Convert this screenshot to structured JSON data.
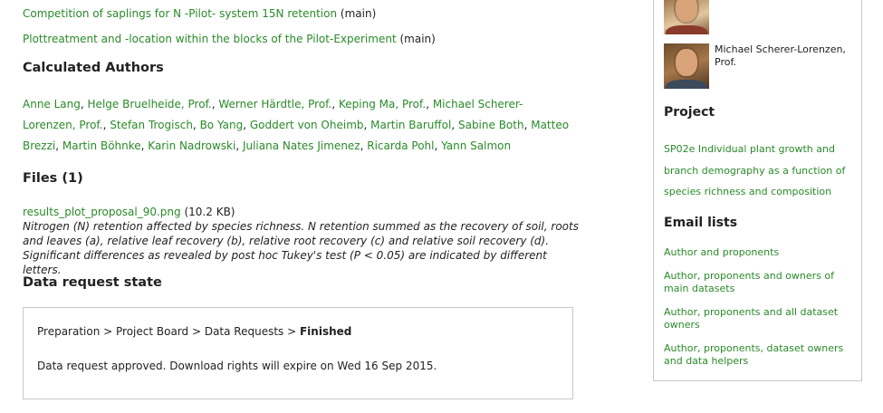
{
  "datasets": [
    {
      "label": "Competition of saplings for N -Pilot- system 15N retention",
      "tag": "(main)"
    },
    {
      "label": "Plottreatment and -location within the blocks of the Pilot-Experiment",
      "tag": "(main)"
    }
  ],
  "calculated_authors": {
    "heading": "Calculated Authors",
    "names": [
      "Anne Lang",
      "Helge Bruelheide, Prof.",
      "Werner Härdtle, Prof.",
      "Keping Ma, Prof.",
      "Michael Scherer-Lorenzen, Prof.",
      "Stefan Trogisch",
      "Bo Yang",
      "Goddert von Oheimb",
      "Martin Baruffol",
      "Sabine Both",
      "Matteo Brezzi",
      "Martin Böhnke",
      "Karin Nadrowski",
      "Juliana Nates Jimenez",
      "Ricarda Pohl",
      "Yann Salmon"
    ]
  },
  "files": {
    "heading": "Files (1)",
    "filename": "results_plot_proposal_90.png",
    "size": "(10.2 KB)",
    "description": "Nitrogen (N) retention affected by species richness. N retention summed as the recovery of soil, roots and leaves (a), relative leaf recovery (b), relative root recovery (c) and relative soil recovery (d). Significant differences as revealed by post hoc Tukey's test (P < 0.05) are indicated by different letters."
  },
  "data_request_state": {
    "heading": "Data request state",
    "path_prefix": "Preparation > Project Board > Data Requests > ",
    "path_current": "Finished",
    "message": "Data request approved. Download rights will expire on Wed 16 Sep 2015."
  },
  "sidebar": {
    "person2_name": "Michael Scherer-Lorenzen, Prof.",
    "project_heading": "Project",
    "project_link": "SP02e Individual plant growth and branch demography as a function of species richness and composition",
    "email_heading": "Email lists",
    "email_links": [
      "Author and proponents",
      "Author, proponents and owners of main datasets",
      "Author, proponents and all dataset owners",
      "Author, proponents, dataset owners and data helpers"
    ]
  }
}
